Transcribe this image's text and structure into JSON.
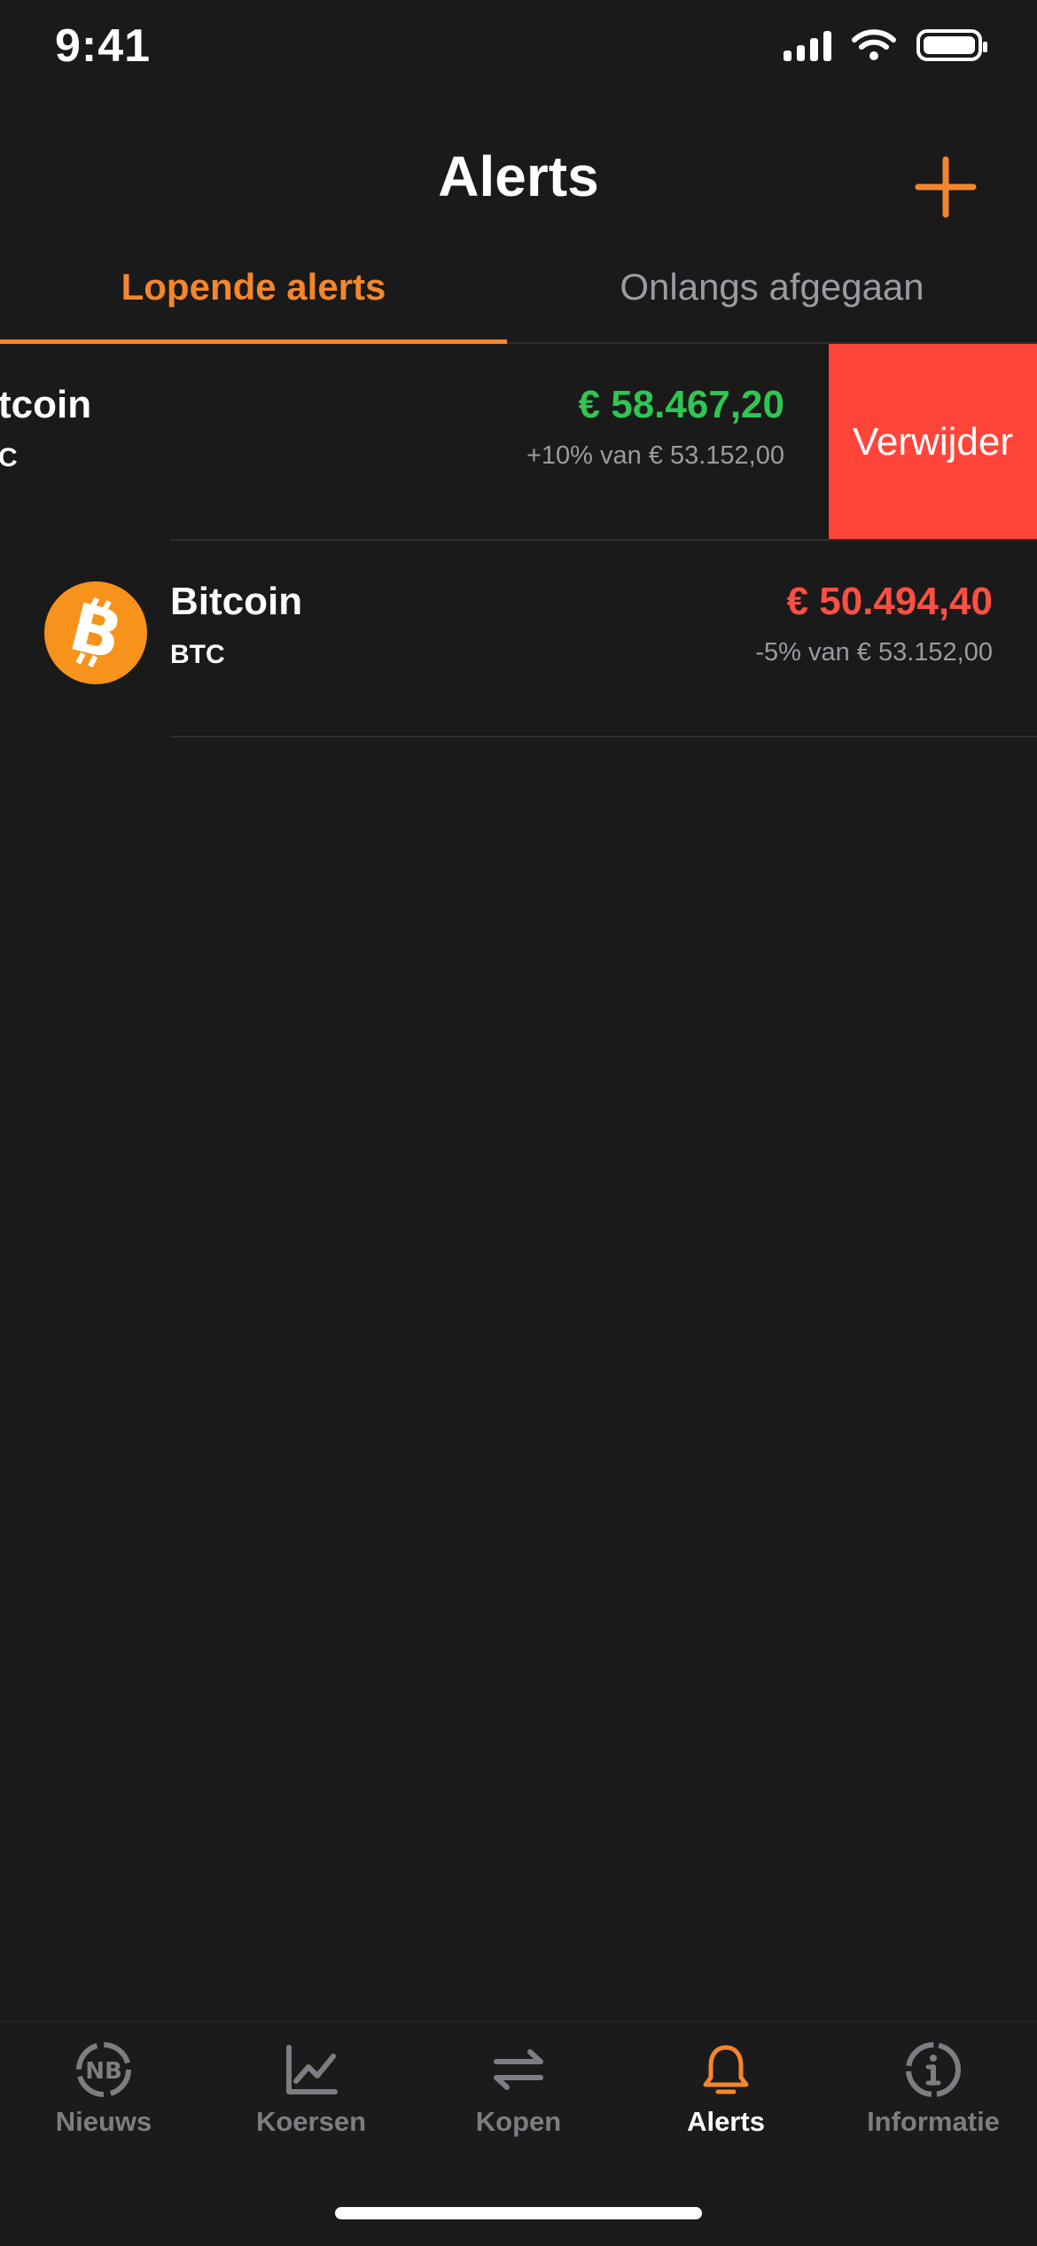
{
  "status_bar": {
    "time": "9:41"
  },
  "header": {
    "title": "Alerts",
    "add_icon": "plus-icon"
  },
  "tabs": [
    {
      "label": "Lopende alerts",
      "active": true
    },
    {
      "label": "Onlangs afgegaan",
      "active": false
    }
  ],
  "alerts": [
    {
      "name": "Bitcoin",
      "name_visible": "tcoin",
      "symbol": "BTC",
      "symbol_visible": "C",
      "price": "€ 58.467,20",
      "condition": "+10% van € 53.152,00",
      "color": "#2fc652",
      "delete_label": "Verwijder"
    },
    {
      "name": "Bitcoin",
      "symbol": "BTC",
      "price": "€ 50.494,40",
      "condition": "-5% van € 53.152,00",
      "color": "#ff4f43",
      "icon": "bitcoin-icon"
    }
  ],
  "tabbar": [
    {
      "label": "Nieuws",
      "icon": "news-icon",
      "active": false
    },
    {
      "label": "Koersen",
      "icon": "chart-icon",
      "active": false
    },
    {
      "label": "Kopen",
      "icon": "swap-icon",
      "active": false
    },
    {
      "label": "Alerts",
      "icon": "bell-icon",
      "active": true
    },
    {
      "label": "Informatie",
      "icon": "info-icon",
      "active": false
    }
  ],
  "colors": {
    "accent": "#f5862c",
    "background": "#1a1a1a",
    "delete": "#ff453a",
    "positive": "#2fc652",
    "negative": "#ff4f43"
  }
}
